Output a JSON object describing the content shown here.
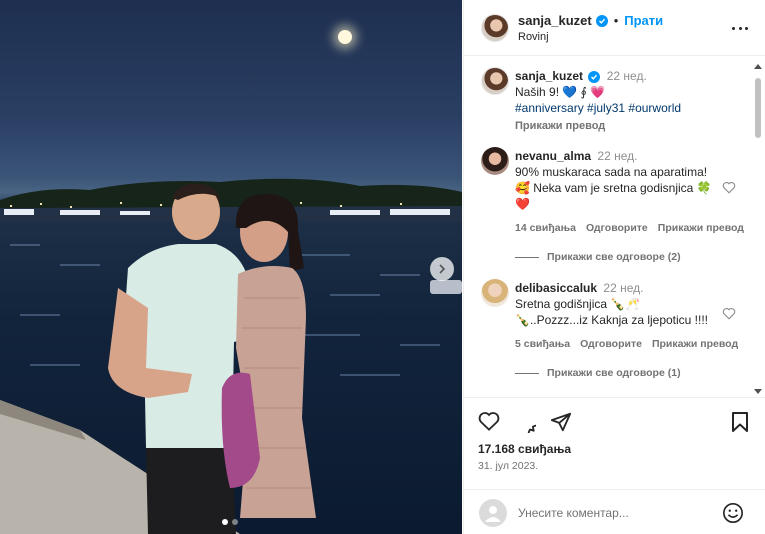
{
  "post": {
    "author": "sanja_kuzet",
    "follow_label": "Прати",
    "separator": "•",
    "location": "Rovinj",
    "likes": "17.168 свиђања",
    "date": "31. јул 2023."
  },
  "caption": {
    "username": "sanja_kuzet",
    "time": "22 нед.",
    "text": "Naših 9! 💙 ∮ 💗",
    "hashtags": "#anniversary #july31 #ourworld",
    "translate_label": "Прикажи превод"
  },
  "comments": [
    {
      "username": "nevanu_alma",
      "time": "22 нед.",
      "text": "90% muskaraca sada na aparatima! 🥰 Neka vam je sretna godisnjica 🍀❤️",
      "likes": "14 свиђања",
      "reply_label": "Одговорите",
      "translate_label": "Прикажи превод",
      "view_replies": "Прикажи све одговоре (2)"
    },
    {
      "username": "delibasiccaluk",
      "time": "22 нед.",
      "text": "Sretna godišnjica 🍾🥂 🍾..Pozzz...iz Kaknja za ljepoticu !!!!",
      "likes": "5 свиђања",
      "reply_label": "Одговорите",
      "translate_label": "Прикажи превод",
      "view_replies": "Прикажи све одговоре (1)"
    }
  ],
  "composer": {
    "placeholder": "Унесите коментар..."
  },
  "icons": {
    "verified": "verified-badge-icon",
    "more": "more-options-icon",
    "like": "heart-icon",
    "comment": "comment-icon",
    "share": "share-icon",
    "save": "bookmark-icon",
    "emoji": "emoji-icon",
    "next": "chevron-right-icon"
  },
  "colors": {
    "accent": "#0095f6",
    "text": "#262626",
    "muted": "#737373"
  },
  "carousel": {
    "slides": 2,
    "active": 1
  }
}
